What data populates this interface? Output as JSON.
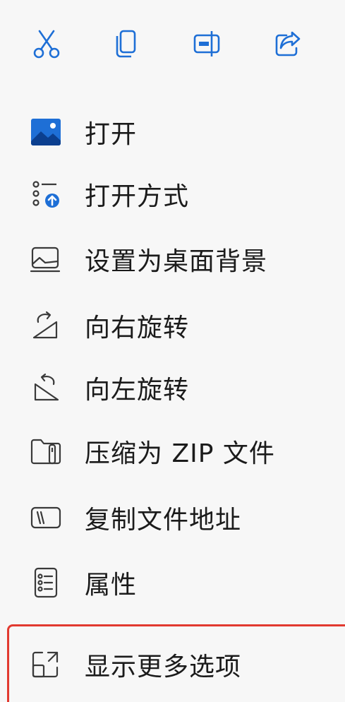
{
  "toolbar": {
    "items": [
      {
        "name": "cut-button",
        "icon": "scissors-icon"
      },
      {
        "name": "copy-button",
        "icon": "copy-icon"
      },
      {
        "name": "rename-button",
        "icon": "rename-icon"
      },
      {
        "name": "share-button",
        "icon": "share-icon"
      }
    ]
  },
  "menu": {
    "items": [
      {
        "label": "打开",
        "icon": "image-icon"
      },
      {
        "label": "打开方式",
        "icon": "open-with-icon"
      },
      {
        "label": "设置为桌面背景",
        "icon": "desktop-background-icon"
      },
      {
        "label": "向右旋转",
        "icon": "rotate-right-icon"
      },
      {
        "label": "向左旋转",
        "icon": "rotate-left-icon"
      },
      {
        "label": "压缩为 ZIP 文件",
        "icon": "zip-folder-icon"
      },
      {
        "label": "复制文件地址",
        "icon": "copy-path-icon"
      },
      {
        "label": "属性",
        "icon": "properties-icon"
      },
      {
        "label": "显示更多选项",
        "icon": "show-more-icon"
      }
    ]
  },
  "colors": {
    "accent": "#1e6fd6",
    "icon_stroke": "#3a3a3a",
    "highlight_border": "#e23a30",
    "background": "#f7f7f7"
  }
}
